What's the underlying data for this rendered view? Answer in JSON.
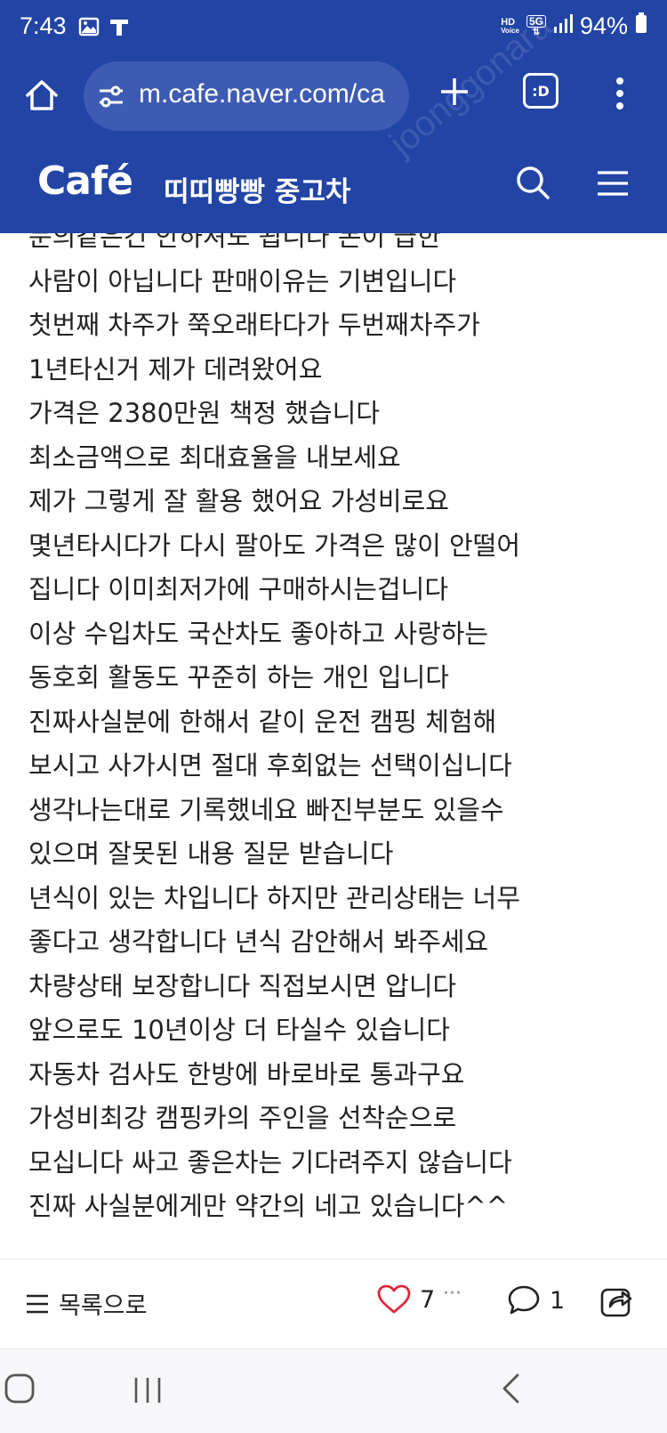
{
  "status_bar": {
    "time": "7:43",
    "battery_percent": "94%",
    "network": "5G",
    "hd_voice_top": "HD",
    "hd_voice_bottom": "Voice"
  },
  "browser": {
    "url": "m.cafe.naver.com/ca",
    "tab_label": ":D"
  },
  "cafe": {
    "logo": "Café",
    "title": "띠띠빵빵 중고차"
  },
  "watermark": "joonggonara",
  "post": {
    "lines": [
      "문의같은건 안하셔도 됩니다 돈이 급한",
      "사람이 아닙니다 판매이유는 기변입니다",
      "첫번째 차주가 쭉오래타다가 두번째차주가",
      "1년타신거 제가 데려왔어요",
      "가격은 2380만원 책정 했습니다",
      "최소금액으로 최대효율을 내보세요",
      "제가 그렇게 잘 활용 했어요 가성비로요",
      "몇년타시다가 다시 팔아도 가격은 많이 안떨어",
      "집니다 이미최저가에 구매하시는겁니다",
      "이상 수입차도 국산차도 좋아하고 사랑하는",
      "동호회 활동도 꾸준히 하는 개인 입니다",
      "진짜사실분에 한해서 같이 운전 캠핑 체험해",
      "보시고 사가시면 절대 후회없는 선택이십니다",
      "생각나는대로 기록했네요 빠진부분도 있을수",
      "있으며 잘못된 내용 질문 받습니다",
      "년식이 있는 차입니다 하지만 관리상태는 너무",
      "좋다고 생각합니다 년식 감안해서 봐주세요",
      "차량상태 보장합니다 직접보시면 압니다",
      "앞으로도 10년이상 더 타실수 있습니다",
      "자동차 검사도 한방에 바로바로 통과구요",
      "가성비최강 캠핑카의 주인을 선착순으로",
      "모십니다 싸고 좋은차는 기다려주지 않습니다",
      "진짜 사실분에게만 약간의 네고 있습니다^^"
    ]
  },
  "bottom_bar": {
    "list_label": "목록으로",
    "like_count": "7",
    "more_label": "···",
    "comment_count": "1"
  },
  "colors": {
    "header_blue": "#2244a5",
    "like_red": "#e0263b"
  }
}
